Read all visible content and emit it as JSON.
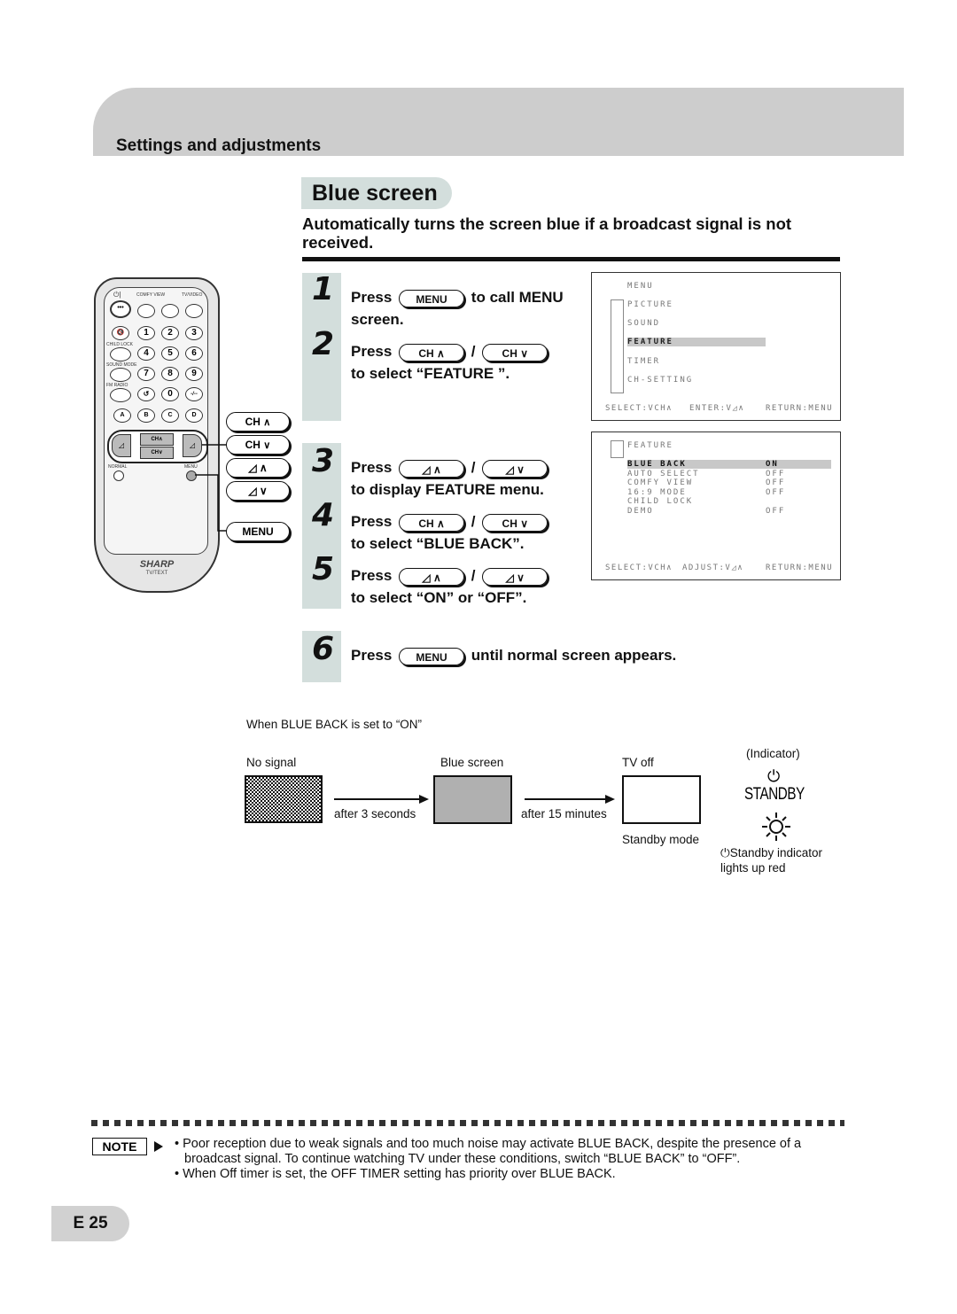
{
  "header": {
    "section": "Settings and adjustments"
  },
  "title": "Blue screen",
  "subtitle": "Automatically turns the screen blue if a broadcast signal is not received.",
  "steps": [
    {
      "num": "1",
      "pre": "Press",
      "buttons": [
        "MENU"
      ],
      "post": "to call MENU",
      "line2": "screen."
    },
    {
      "num": "2",
      "pre": "Press",
      "buttons": [
        "CH ∧",
        "CH ∨"
      ],
      "sep": "/",
      "line2": "to select “FEATURE ”."
    },
    {
      "num": "3",
      "pre": "Press",
      "buttons": [
        "VOL ∧",
        "VOL ∨"
      ],
      "sep": "/",
      "line2": "to display FEATURE menu."
    },
    {
      "num": "4",
      "pre": "Press",
      "buttons": [
        "CH ∧",
        "CH ∨"
      ],
      "sep": "/",
      "line2": "to select “BLUE BACK”."
    },
    {
      "num": "5",
      "pre": "Press",
      "buttons": [
        "VOL ∧",
        "VOL ∨"
      ],
      "sep": "/",
      "line2": "to select “ON” or “OFF”."
    },
    {
      "num": "6",
      "pre": "Press",
      "buttons": [
        "MENU"
      ],
      "post": "until normal screen appears."
    }
  ],
  "menu_screen": {
    "title": "MENU",
    "items": [
      "PICTURE",
      "SOUND",
      "FEATURE",
      "TIMER",
      "CH-SETTING"
    ],
    "selected": "FEATURE",
    "footer": [
      "SELECT:VCH∧",
      "ENTER:V◿∧",
      "RETURN:MENU"
    ]
  },
  "feature_screen": {
    "title": "FEATURE",
    "items": [
      {
        "label": "BLUE BACK",
        "value": "ON"
      },
      {
        "label": "AUTO SELECT",
        "value": "OFF"
      },
      {
        "label": "COMFY VIEW",
        "value": "OFF"
      },
      {
        "label": "16:9 MODE",
        "value": "OFF"
      },
      {
        "label": "CHILD LOCK",
        "value": ""
      },
      {
        "label": "DEMO",
        "value": "OFF"
      }
    ],
    "selected": "BLUE BACK",
    "footer": [
      "SELECT:VCH∧",
      "ADJUST:V◿∧",
      "RETURN:MENU"
    ]
  },
  "remote": {
    "brand": "SHARP",
    "model": "TV/TEXT",
    "labels": {
      "comfy": "COMFY VIEW",
      "tvvideo": "TV/VIDEO",
      "childlock": "CHILD LOCK",
      "soundmode": "SOUND MODE",
      "fmradio": "FM RADIO",
      "normal": "NORMAL",
      "menu": "MENU"
    },
    "digits": [
      "1",
      "2",
      "3",
      "4",
      "5",
      "6",
      "7",
      "8",
      "9",
      "0"
    ],
    "letters": [
      "A",
      "B",
      "C",
      "D"
    ],
    "callouts": [
      "CH ∧",
      "CH ∨",
      "VOL ∧",
      "VOL ∨",
      "MENU"
    ]
  },
  "diagram": {
    "caption": "When BLUE BACK is set to “ON”",
    "states": [
      "No signal",
      "Blue screen",
      "TV off"
    ],
    "transitions": [
      "after 3 seconds",
      "after 15 minutes"
    ],
    "standby_mode": "Standby mode",
    "indicator_label": "(Indicator)",
    "standby_text": "STANDBY",
    "indicator_note_1": "Standby indicator",
    "indicator_note_2": "lights up red"
  },
  "note": {
    "badge": "NOTE",
    "items": [
      "• Poor reception due to weak signals and too much noise may activate BLUE BACK, despite the presence of a broadcast signal. To continue watching TV under these conditions, switch “BLUE BACK” to “OFF”.",
      "• When Off timer is set, the OFF TIMER setting has priority over BLUE BACK."
    ]
  },
  "page_number": "E 25"
}
